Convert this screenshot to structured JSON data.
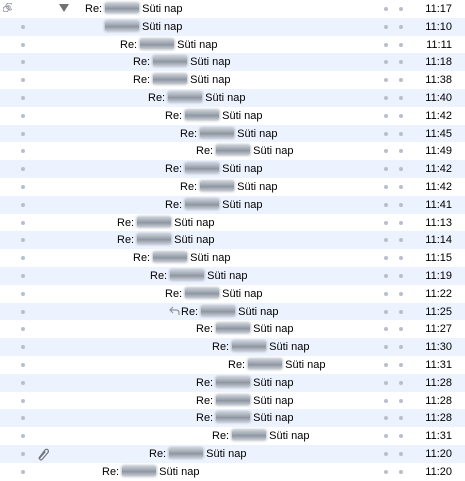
{
  "messages": [
    {
      "prefix": "Re:",
      "suffix": "Süti nap",
      "time": "11:17"
    },
    {
      "prefix": "",
      "suffix": "Süti nap",
      "time": "11:10"
    },
    {
      "prefix": "Re:",
      "suffix": "Süti nap",
      "time": "11:11"
    },
    {
      "prefix": "Re:",
      "suffix": "Süti nap",
      "time": "11:18"
    },
    {
      "prefix": "Re:",
      "suffix": "Süti nap",
      "time": "11:38"
    },
    {
      "prefix": "Re:",
      "suffix": "Süti nap",
      "time": "11:40"
    },
    {
      "prefix": "Re:",
      "suffix": "Süti nap",
      "time": "11:42"
    },
    {
      "prefix": "Re:",
      "suffix": "Süti nap",
      "time": "11:45"
    },
    {
      "prefix": "Re:",
      "suffix": "Süti nap",
      "time": "11:49"
    },
    {
      "prefix": "Re:",
      "suffix": "Süti nap",
      "time": "11:42"
    },
    {
      "prefix": "Re:",
      "suffix": "Süti nap",
      "time": "11:42"
    },
    {
      "prefix": "Re:",
      "suffix": "Süti nap",
      "time": "11:41"
    },
    {
      "prefix": "Re:",
      "suffix": "Süti nap",
      "time": "11:13"
    },
    {
      "prefix": "Re:",
      "suffix": "Süti nap",
      "time": "11:14"
    },
    {
      "prefix": "Re:",
      "suffix": "Süti nap",
      "time": "11:15"
    },
    {
      "prefix": "Re:",
      "suffix": "Süti nap",
      "time": "11:19"
    },
    {
      "prefix": "Re:",
      "suffix": "Süti nap",
      "time": "11:22"
    },
    {
      "prefix": "Re:",
      "suffix": "Süti nap",
      "time": "11:25"
    },
    {
      "prefix": "Re:",
      "suffix": "Süti nap",
      "time": "11:27"
    },
    {
      "prefix": "Re:",
      "suffix": "Süti nap",
      "time": "11:30"
    },
    {
      "prefix": "Re:",
      "suffix": "Süti nap",
      "time": "11:31"
    },
    {
      "prefix": "Re:",
      "suffix": "Süti nap",
      "time": "11:28"
    },
    {
      "prefix": "Re:",
      "suffix": "Süti nap",
      "time": "11:28"
    },
    {
      "prefix": "Re:",
      "suffix": "Süti nap",
      "time": "11:28"
    },
    {
      "prefix": "Re:",
      "suffix": "Süti nap",
      "time": "11:31"
    },
    {
      "prefix": "Re:",
      "suffix": "Süti nap",
      "time": "11:20"
    },
    {
      "prefix": "Re:",
      "suffix": "Süti nap",
      "time": "11:20"
    }
  ],
  "icons": {
    "thread_root": "thread-spiral-icon",
    "disclosure": "disclosure-triangle-down-icon",
    "replied": "reply-arrow-icon",
    "attachment": "paperclip-icon"
  },
  "colors": {
    "alt_row": "#edf3fe",
    "dot": "#b9bfc9",
    "triangle": "#707070"
  }
}
